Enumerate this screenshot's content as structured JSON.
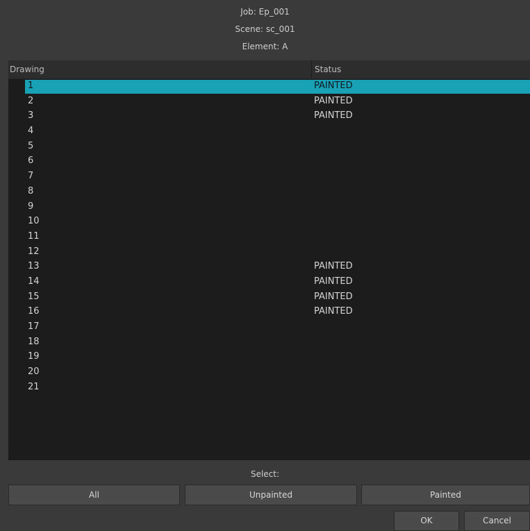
{
  "header": {
    "job": "Job: Ep_001",
    "scene": "Scene: sc_001",
    "element": "Element: A"
  },
  "table": {
    "columns": [
      "Drawing",
      "Status"
    ],
    "selected_index": 0,
    "rows": [
      {
        "drawing": "1",
        "status": "PAINTED"
      },
      {
        "drawing": "2",
        "status": "PAINTED"
      },
      {
        "drawing": "3",
        "status": "PAINTED"
      },
      {
        "drawing": "4",
        "status": ""
      },
      {
        "drawing": "5",
        "status": ""
      },
      {
        "drawing": "6",
        "status": ""
      },
      {
        "drawing": "7",
        "status": ""
      },
      {
        "drawing": "8",
        "status": ""
      },
      {
        "drawing": "9",
        "status": ""
      },
      {
        "drawing": "10",
        "status": ""
      },
      {
        "drawing": "11",
        "status": ""
      },
      {
        "drawing": "12",
        "status": ""
      },
      {
        "drawing": "13",
        "status": "PAINTED"
      },
      {
        "drawing": "14",
        "status": "PAINTED"
      },
      {
        "drawing": "15",
        "status": "PAINTED"
      },
      {
        "drawing": "16",
        "status": "PAINTED"
      },
      {
        "drawing": "17",
        "status": ""
      },
      {
        "drawing": "18",
        "status": ""
      },
      {
        "drawing": "19",
        "status": ""
      },
      {
        "drawing": "20",
        "status": ""
      },
      {
        "drawing": "21",
        "status": ""
      }
    ]
  },
  "select": {
    "label": "Select:",
    "all": "All",
    "unpainted": "Unpainted",
    "painted": "Painted"
  },
  "actions": {
    "ok": "OK",
    "cancel": "Cancel"
  },
  "colors": {
    "selection": "#19a2b6",
    "background": "#3a3a3a",
    "list_background": "#1c1c1c"
  }
}
